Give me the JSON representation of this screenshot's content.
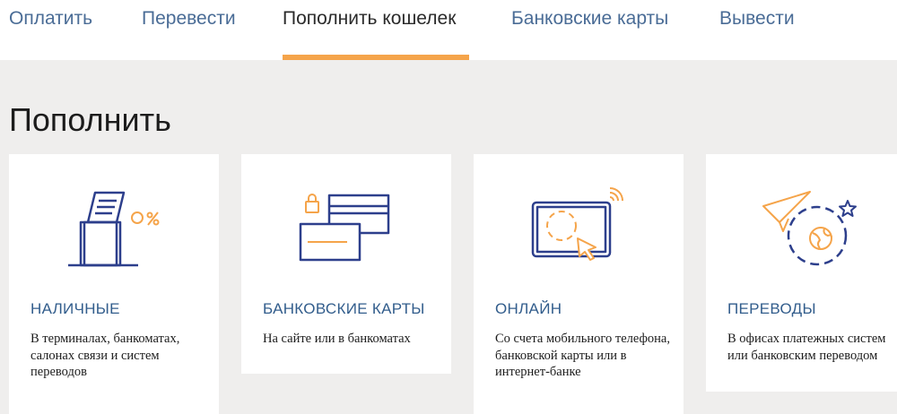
{
  "nav": {
    "tabs": [
      {
        "label": "Оплатить",
        "active": false
      },
      {
        "label": "Перевести",
        "active": false
      },
      {
        "label": "Пополнить кошелек",
        "active": true
      },
      {
        "label": "Банковские карты",
        "active": false
      },
      {
        "label": "Вывести",
        "active": false
      }
    ]
  },
  "page": {
    "title": "Пополнить"
  },
  "cards": [
    {
      "title": "НАЛИЧНЫЕ",
      "description": "В терминалах, банкоматах, салонах связи и систем переводов",
      "icon": "terminal-icon",
      "icon_badge": "0%"
    },
    {
      "title": "БАНКОВСКИЕ КАРТЫ",
      "description": "На сайте или в банкоматах",
      "icon": "bank-cards-icon"
    },
    {
      "title": "ОНЛАЙН",
      "description": "Со счета мобильного телефона, банковской карты или в интернет-банке",
      "icon": "online-tablet-icon"
    },
    {
      "title": "ПЕРЕВОДЫ",
      "description": "В офисах платежных систем или банковским переводом",
      "icon": "paper-plane-globe-icon"
    }
  ],
  "colors": {
    "accent": "#f5a44a",
    "icon_blue": "#2d3f8c",
    "link": "#4a6c96",
    "card_title": "#325d8c",
    "background": "#efeeed"
  }
}
